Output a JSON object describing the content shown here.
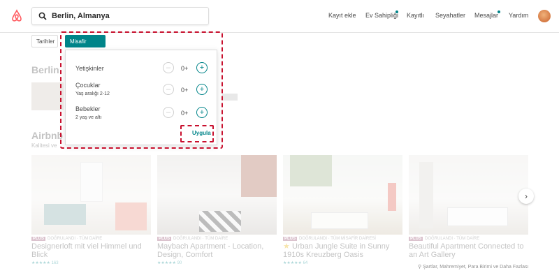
{
  "search": {
    "value": "Berlin, Almanya"
  },
  "nav": {
    "host_label": "Kayıt ekle",
    "ev_sahipligi_label": "Ev Sahipliği",
    "saved_label": "Kayıtlı",
    "trips_label": "Seyahatler",
    "messages_label": "Mesajlar",
    "help_label": "Yardım"
  },
  "filters": {
    "dates_label": "Tarihler",
    "guests_label": "Misafir sayısı"
  },
  "guests_popover": {
    "adults": {
      "label": "Yetişkinler",
      "count": "0+"
    },
    "children": {
      "label": "Çocuklar",
      "sub": "Yaş aralığı 2-12",
      "count": "0+"
    },
    "infants": {
      "label": "Bebekler",
      "sub": "2 yaş ve altı",
      "count": "0+"
    },
    "apply_label": "Uygula"
  },
  "background": {
    "section1_title": "Berlin",
    "section2_title": "Airbnb",
    "section2_sub": "Kalitesi ve",
    "listings": [
      {
        "badge": "PLUS",
        "type": "DOĞRULANDI · TÜM DAİRE",
        "title": "Designerloft mit viel Himmel und Blick",
        "reviews": "163"
      },
      {
        "badge": "PLUS",
        "type": "DOĞRULANDI · TÜM DAİRE",
        "title": "Maybach Apartment - Location, Design, Comfort",
        "reviews": "90"
      },
      {
        "badge": "PLUS",
        "type": "DOĞRULANDI · TÜM MİSAFİR DAİRESİ",
        "title": "Urban Jungle Suite in Sunny 1910s Kreuzberg Oasis",
        "reviews": "64"
      },
      {
        "badge": "PLUS",
        "type": "DOĞRULANDI · TÜM DAİRE",
        "title": "Beautiful Apartment Connected to an Art Gallery",
        "reviews": ""
      }
    ],
    "amenities_text": "Şartlar, Mahremiyet, Para Birimi ve Daha Fazlası"
  },
  "colors": {
    "teal": "#008489",
    "annotation": "#c8102e",
    "brand": "#ff5a5f"
  }
}
